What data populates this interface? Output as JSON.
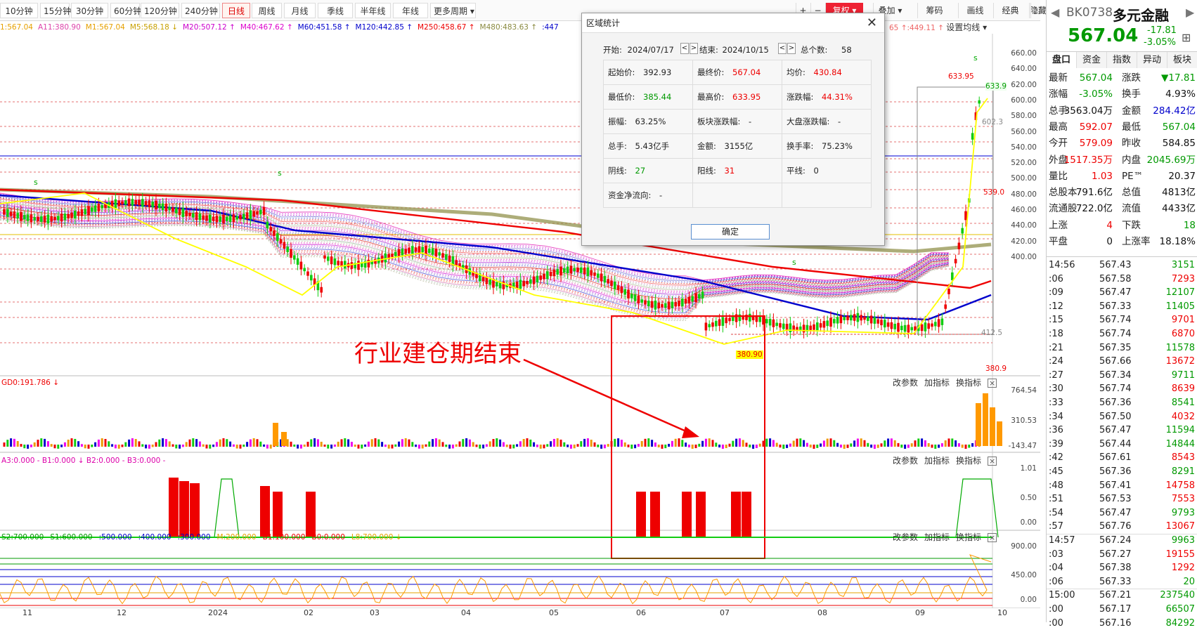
{
  "toolbar": {
    "periods": [
      "10分钟",
      "15分钟",
      "30分钟",
      "60分钟",
      "120分钟",
      "240分钟",
      "日线",
      "周线",
      "月线",
      "季线",
      "半年线",
      "年线",
      "更多周期 ▾"
    ],
    "active": "日线",
    "right": [
      "+",
      "−",
      "复权 ▾",
      "叠加 ▾",
      "筹码",
      "画线",
      "经典",
      "隐藏 ▾"
    ],
    "expand": "⛶"
  },
  "ma_line": [
    {
      "t": "1:567.04",
      "c": "#e6a000"
    },
    {
      "t": "A11:380.90",
      "c": "#d4a"
    },
    {
      "t": "M1:567.04",
      "c": "#e6a000"
    },
    {
      "t": "M5:568.18 ↓",
      "c": "#c8a000"
    },
    {
      "t": "M20:507.12 ↑",
      "c": "#c0c"
    },
    {
      "t": "M40:467.62 ↑",
      "c": "#d0c"
    },
    {
      "t": "M60:451.58 ↑",
      "c": "#00c"
    },
    {
      "t": "M120:442.85 ↑",
      "c": "#00c"
    },
    {
      "t": "M250:458.67 ↑",
      "c": "#e00"
    },
    {
      "t": "M480:483.63 ↑",
      "c": "#8a8a40"
    },
    {
      "t": ":447",
      "c": "#00c"
    }
  ],
  "ma_right": {
    "a": "65 ↑:449.11 ↑",
    "b": "设置均线 ▾"
  },
  "price_axis": [
    "660.00",
    "640.00",
    "620.00",
    "600.00",
    "580.00",
    "560.00",
    "540.00",
    "520.00",
    "500.00",
    "480.00",
    "460.00",
    "440.00",
    "420.00",
    "400.00"
  ],
  "chart_labels": {
    "high": "633.95",
    "low": "380.90",
    "hi_right": "633.9",
    "low_right": "380.9",
    "r602": "602.3",
    "r539": "539.0",
    "r412": "412.5",
    "s": "s"
  },
  "panel1": {
    "title": "GD0:191.786 ↓",
    "axis": [
      "764.54",
      "310.53",
      "-143.47"
    ]
  },
  "panel2": {
    "title": "A3:0.000 - B1:0.000 ↓ B2:0.000 - B3:0.000 -",
    "axis": [
      "1.01",
      "0.50",
      "0.00"
    ]
  },
  "panel3": {
    "items": [
      {
        "t": "S2:700.000",
        "c": "#090"
      },
      {
        "t": "S1:600.000",
        "c": "#090"
      },
      {
        "t": ":500.000",
        "c": "#00c"
      },
      {
        "t": ":400.000",
        "c": "#00c"
      },
      {
        "t": ":300.000",
        "c": "#00c"
      },
      {
        "t": "M:200.000",
        "c": "#e6a000"
      },
      {
        "t": "B1:100.000",
        "c": "#e00"
      },
      {
        "t": "B0:0.000",
        "c": "#e00"
      },
      {
        "t": "L8:700.000 ↓",
        "c": "#e6a000"
      }
    ],
    "axis": [
      "900.00",
      "450.00",
      "0.00"
    ]
  },
  "panel_ctl": [
    "改参数",
    "加指标",
    "换指标"
  ],
  "x_labels": [
    "11",
    "12",
    "2024",
    "02",
    "03",
    "04",
    "05",
    "06",
    "07",
    "08",
    "09",
    "10"
  ],
  "annotation": "行业建仓期结束",
  "dialog": {
    "title": "区域统计",
    "start_label": "开始:",
    "start": "2024/07/17",
    "end_label": "结束:",
    "end": "2024/10/15",
    "count_label": "总个数:",
    "count": "58",
    "rows": [
      [
        {
          "l": "起始价:",
          "v": "392.93",
          "c": ""
        },
        {
          "l": "最终价:",
          "v": "567.04",
          "c": "red"
        },
        {
          "l": "均价:",
          "v": "430.84",
          "c": "red"
        }
      ],
      [
        {
          "l": "最低价:",
          "v": "385.44",
          "c": "grn"
        },
        {
          "l": "最高价:",
          "v": "633.95",
          "c": "red"
        },
        {
          "l": "涨跌幅:",
          "v": "44.31%",
          "c": "red"
        }
      ],
      [
        {
          "l": "振幅:",
          "v": "63.25%",
          "c": ""
        },
        {
          "l": "板块涨跌幅:",
          "v": "-",
          "c": ""
        },
        {
          "l": "大盘涨跌幅:",
          "v": "-",
          "c": ""
        }
      ],
      [
        {
          "l": "总手:",
          "v": "5.43亿手",
          "c": ""
        },
        {
          "l": "金额:",
          "v": "3155亿",
          "c": ""
        },
        {
          "l": "换手率:",
          "v": "75.23%",
          "c": ""
        }
      ],
      [
        {
          "l": "阴线:",
          "v": "27",
          "c": "grn"
        },
        {
          "l": "阳线:",
          "v": "31",
          "c": "red"
        },
        {
          "l": "平线:",
          "v": "0",
          "c": ""
        }
      ],
      [
        {
          "l": "资金净流向:",
          "v": "-",
          "c": ""
        },
        {
          "l": "",
          "v": "",
          "c": ""
        },
        {
          "l": "",
          "v": "",
          "c": ""
        }
      ]
    ],
    "ok": "确定"
  },
  "side": {
    "code": "BK0738",
    "name": "多元金融",
    "price": "567.04",
    "chg": "-17.81",
    "pct": "-3.05%",
    "tabs": [
      "盘口",
      "资金",
      "指数",
      "异动",
      "板块"
    ],
    "quote": [
      [
        "最新",
        "567.04",
        "grn",
        "涨跌",
        "▼17.81",
        "grn"
      ],
      [
        "涨幅",
        "-3.05%",
        "grn",
        "换手",
        "4.93%",
        ""
      ],
      [
        "总手",
        "3563.04万",
        "",
        "金额",
        "284.42亿",
        "blu"
      ],
      [
        "最高",
        "592.07",
        "red",
        "最低",
        "567.04",
        "grn"
      ],
      [
        "今开",
        "579.09",
        "red",
        "昨收",
        "584.85",
        ""
      ],
      [
        "外盘",
        "1517.35万",
        "red",
        "内盘",
        "2045.69万",
        "grn"
      ],
      [
        "量比",
        "1.03",
        "red",
        "PE™",
        "20.37",
        ""
      ],
      [
        "总股本",
        "791.6亿",
        "",
        "总值",
        "4813亿",
        ""
      ],
      [
        "流通股",
        "722.0亿",
        "",
        "流值",
        "4433亿",
        ""
      ],
      [
        "上涨",
        "4",
        "red",
        "下跌",
        "18",
        "grn"
      ],
      [
        "平盘",
        "0",
        "",
        "上涨率",
        "18.18%",
        ""
      ]
    ],
    "ticks": [
      [
        "14:56",
        "567.43",
        "3151",
        "grn"
      ],
      [
        ":06",
        "567.58",
        "7293",
        "red"
      ],
      [
        ":09",
        "567.47",
        "12107",
        "grn"
      ],
      [
        ":12",
        "567.33",
        "11405",
        "grn"
      ],
      [
        ":15",
        "567.74",
        "9701",
        "red"
      ],
      [
        ":18",
        "567.74",
        "6870",
        "red"
      ],
      [
        ":21",
        "567.35",
        "11578",
        "grn"
      ],
      [
        ":24",
        "567.66",
        "13672",
        "red"
      ],
      [
        ":27",
        "567.34",
        "9711",
        "grn"
      ],
      [
        ":30",
        "567.74",
        "8639",
        "red"
      ],
      [
        ":33",
        "567.36",
        "8541",
        "grn"
      ],
      [
        ":34",
        "567.50",
        "4032",
        "red"
      ],
      [
        ":36",
        "567.47",
        "11594",
        "grn"
      ],
      [
        ":39",
        "567.44",
        "14844",
        "grn"
      ],
      [
        ":42",
        "567.61",
        "8543",
        "red"
      ],
      [
        ":45",
        "567.36",
        "8291",
        "grn"
      ],
      [
        ":48",
        "567.41",
        "14758",
        "red"
      ],
      [
        ":51",
        "567.53",
        "7553",
        "red"
      ],
      [
        ":54",
        "567.47",
        "9793",
        "grn"
      ],
      [
        ":57",
        "567.76",
        "13067",
        "red"
      ],
      [
        "14:57",
        "567.24",
        "9963",
        "grn"
      ],
      [
        ":03",
        "567.27",
        "19155",
        "red"
      ],
      [
        ":04",
        "567.38",
        "1292",
        "red"
      ],
      [
        ":06",
        "567.33",
        "20",
        "grn"
      ],
      [
        "15:00",
        "567.21",
        "237540",
        "grn"
      ],
      [
        ":00",
        "567.17",
        "66507",
        "grn"
      ],
      [
        ":00",
        "567.16",
        "84292",
        "grn"
      ]
    ]
  },
  "colors": {
    "up": "#e00",
    "down": "#1c1",
    "ma60": "#0000c8",
    "ma250": "#e00",
    "ma480": "#8a8a40"
  }
}
